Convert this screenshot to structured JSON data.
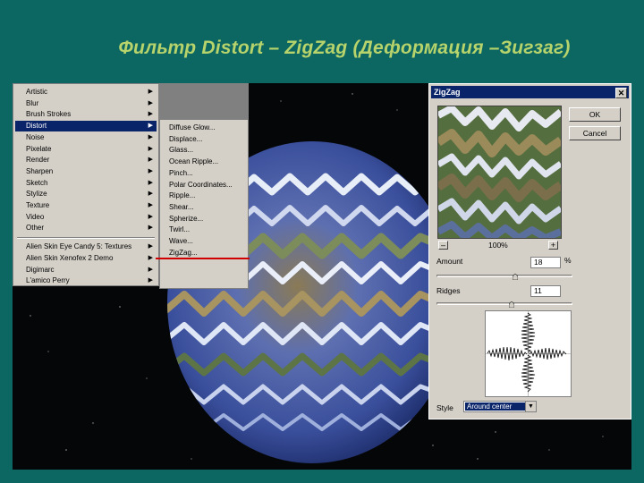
{
  "slide": {
    "title": "Фильтр Distort – ZigZag (Деформация –Зигзаг)"
  },
  "filter_menu": {
    "items": [
      {
        "label": "Artistic"
      },
      {
        "label": "Blur"
      },
      {
        "label": "Brush Strokes"
      },
      {
        "label": "Distort",
        "selected": true
      },
      {
        "label": "Noise"
      },
      {
        "label": "Pixelate"
      },
      {
        "label": "Render"
      },
      {
        "label": "Sharpen"
      },
      {
        "label": "Sketch"
      },
      {
        "label": "Stylize"
      },
      {
        "label": "Texture"
      },
      {
        "label": "Video"
      },
      {
        "label": "Other"
      },
      {
        "label": "Alien Skin Eye Candy 5: Textures"
      },
      {
        "label": "Alien Skin Xenofex 2 Demo"
      },
      {
        "label": "Digimarc"
      },
      {
        "label": "L'amico Perry"
      }
    ],
    "arrow_icon": "chevron-right-icon"
  },
  "distort_submenu": {
    "items": [
      {
        "label": "Diffuse Glow..."
      },
      {
        "label": "Displace..."
      },
      {
        "label": "Glass..."
      },
      {
        "label": "Ocean Ripple..."
      },
      {
        "label": "Pinch..."
      },
      {
        "label": "Polar Coordinates..."
      },
      {
        "label": "Ripple..."
      },
      {
        "label": "Shear..."
      },
      {
        "label": "Spherize..."
      },
      {
        "label": "Twirl..."
      },
      {
        "label": "Wave..."
      },
      {
        "label": "ZigZag..."
      }
    ]
  },
  "dialog": {
    "title": "ZigZag",
    "close_label": "✕",
    "ok_label": "OK",
    "cancel_label": "Cancel",
    "zoom_out": "–",
    "zoom_level": "100%",
    "zoom_in": "+",
    "amount_label": "Amount",
    "amount_value": "18",
    "amount_unit": "%",
    "amount_slider_fraction": 0.58,
    "ridges_label": "Ridges",
    "ridges_value": "11",
    "ridges_slider_fraction": 0.55,
    "style_label": "Style",
    "style_value": "Around center",
    "dropdown_icon": "chevron-down-icon"
  },
  "colors": {
    "background": "#0c6661",
    "title": "#b7d36b",
    "selection": "#0a246a",
    "highlight_line": "#d00000"
  }
}
